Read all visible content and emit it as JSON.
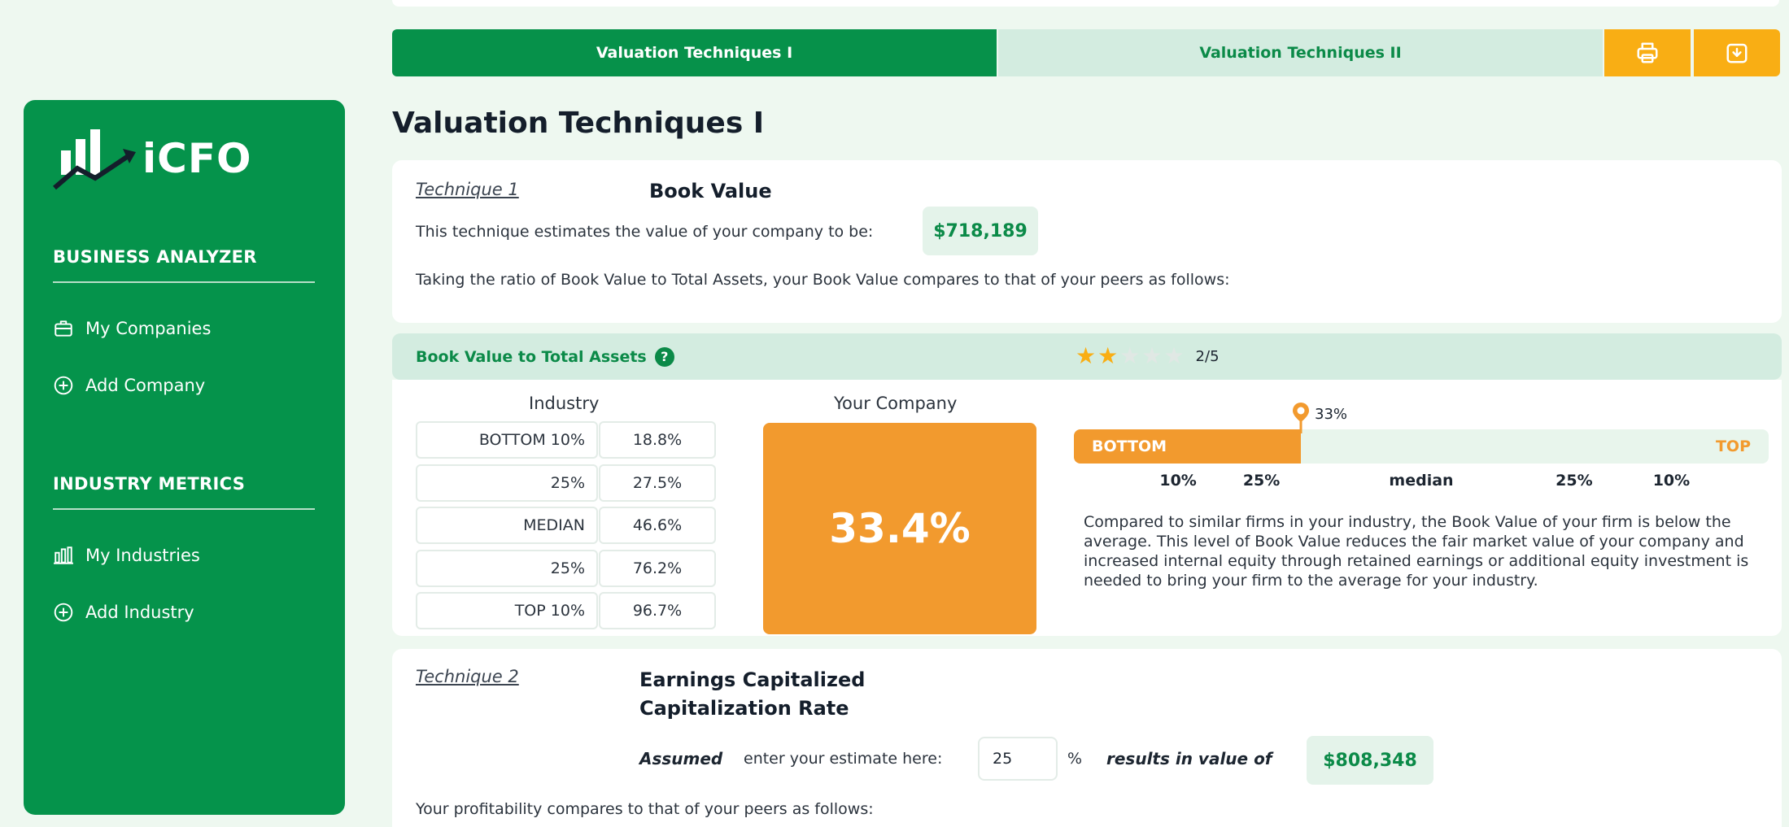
{
  "tabs": [
    {
      "label": "Valuation Techniques I",
      "active": true
    },
    {
      "label": "Valuation Techniques II",
      "active": false
    }
  ],
  "toolbar": {
    "print_icon": "print-icon",
    "download_icon": "download-icon"
  },
  "sidebar": {
    "logo_text": "iCFO",
    "sections": [
      {
        "heading": "BUSINESS ANALYZER",
        "items": [
          {
            "label": "My Companies",
            "icon": "briefcase-icon"
          },
          {
            "label": "Add Company",
            "icon": "plus-circle-icon"
          }
        ]
      },
      {
        "heading": "INDUSTRY METRICS",
        "items": [
          {
            "label": "My Industries",
            "icon": "bar-chart-icon"
          },
          {
            "label": "Add Industry",
            "icon": "plus-circle-icon"
          }
        ]
      }
    ]
  },
  "page_title": "Valuation Techniques I",
  "technique1": {
    "label": "Technique 1",
    "title": "Book Value",
    "estimate_text": "This technique estimates the value of your company to be:",
    "estimate_value": "$718,189",
    "compare_text": "Taking the ratio of Book Value to Total Assets, your Book Value compares to that of your peers as follows:"
  },
  "metric": {
    "name": "Book Value to Total Assets",
    "help": "?",
    "rating": 2,
    "rating_max": 5,
    "rating_text": "2/5",
    "industry_header": "Industry",
    "your_header": "Your Company",
    "industry_rows": [
      {
        "label": "BOTTOM 10%",
        "value": "18.8%"
      },
      {
        "label": "25%",
        "value": "27.5%"
      },
      {
        "label": "MEDIAN",
        "value": "46.6%"
      },
      {
        "label": "25%",
        "value": "76.2%"
      },
      {
        "label": "TOP 10%",
        "value": "96.7%"
      }
    ],
    "your_value": "33.4%",
    "marker_label": "33%",
    "marker_position": 0.33,
    "scale_bottom": "BOTTOM",
    "scale_top": "TOP",
    "scale_ticks": [
      "10%",
      "25%",
      "median",
      "25%",
      "10%"
    ],
    "explanation": "Compared to similar firms in your industry, the Book Value of your firm is below the average. This level of Book Value reduces the fair market value of your company and increased internal equity through retained earnings or additional equity investment is needed to bring your firm to the average for your industry."
  },
  "technique2": {
    "label": "Technique 2",
    "title_line1": "Earnings Capitalized",
    "title_line2": "Capitalization Rate",
    "assumed": "Assumed",
    "enter_text": "enter your estimate here:",
    "rate_value": "25",
    "percent": "%",
    "results_text": "results in value of",
    "result_value": "$808,348",
    "compare_text": "Your profitability compares to that of your peers as follows:"
  },
  "colors": {
    "green": "#05934b",
    "light_green": "#d3ece0",
    "orange": "#f29a2e",
    "yellow": "#f9ae14"
  }
}
